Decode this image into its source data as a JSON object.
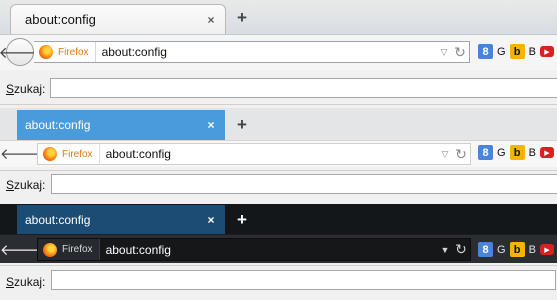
{
  "variants": [
    {
      "tab": {
        "title": "about:config",
        "close": "×"
      },
      "newtab": "+",
      "back": "🡐",
      "identity": "Firefox",
      "url": "about:config",
      "dropmarker": "▽",
      "reload": "↻",
      "engines": [
        {
          "badge": "8",
          "label": "G"
        },
        {
          "badge": "b",
          "label": "B"
        },
        {
          "badge": "▶",
          "label": ""
        }
      ],
      "search": {
        "label_prefix": "S",
        "label_rest": "zukaj:",
        "value": ""
      }
    },
    {
      "tab": {
        "title": "about:config",
        "close": "×"
      },
      "newtab": "+",
      "back": "🡐",
      "identity": "Firefox",
      "url": "about:config",
      "dropmarker": "▽",
      "reload": "↻",
      "engines": [
        {
          "badge": "8",
          "label": "G"
        },
        {
          "badge": "b",
          "label": "B"
        },
        {
          "badge": "▶",
          "label": ""
        }
      ],
      "search": {
        "label_prefix": "S",
        "label_rest": "zukaj:",
        "value": ""
      }
    },
    {
      "tab": {
        "title": "about:config",
        "close": "×"
      },
      "newtab": "+",
      "back": "🡐",
      "identity": "Firefox",
      "url": "about:config",
      "dropmarker": "▼",
      "reload": "↻",
      "engines": [
        {
          "badge": "8",
          "label": "G"
        },
        {
          "badge": "b",
          "label": "B"
        },
        {
          "badge": "▶",
          "label": ""
        }
      ],
      "search": {
        "label_prefix": "S",
        "label_rest": "zukaj:",
        "value": ""
      }
    }
  ],
  "colors": {
    "tab_blue": "#4a9bdc",
    "tab_dark": "#1c4c73",
    "dark_strip": "#14171a",
    "firefox_orange": "#e07a17",
    "google_blue": "#4a84d9",
    "bing_yellow": "#f4b400",
    "youtube_red": "#d92121"
  }
}
